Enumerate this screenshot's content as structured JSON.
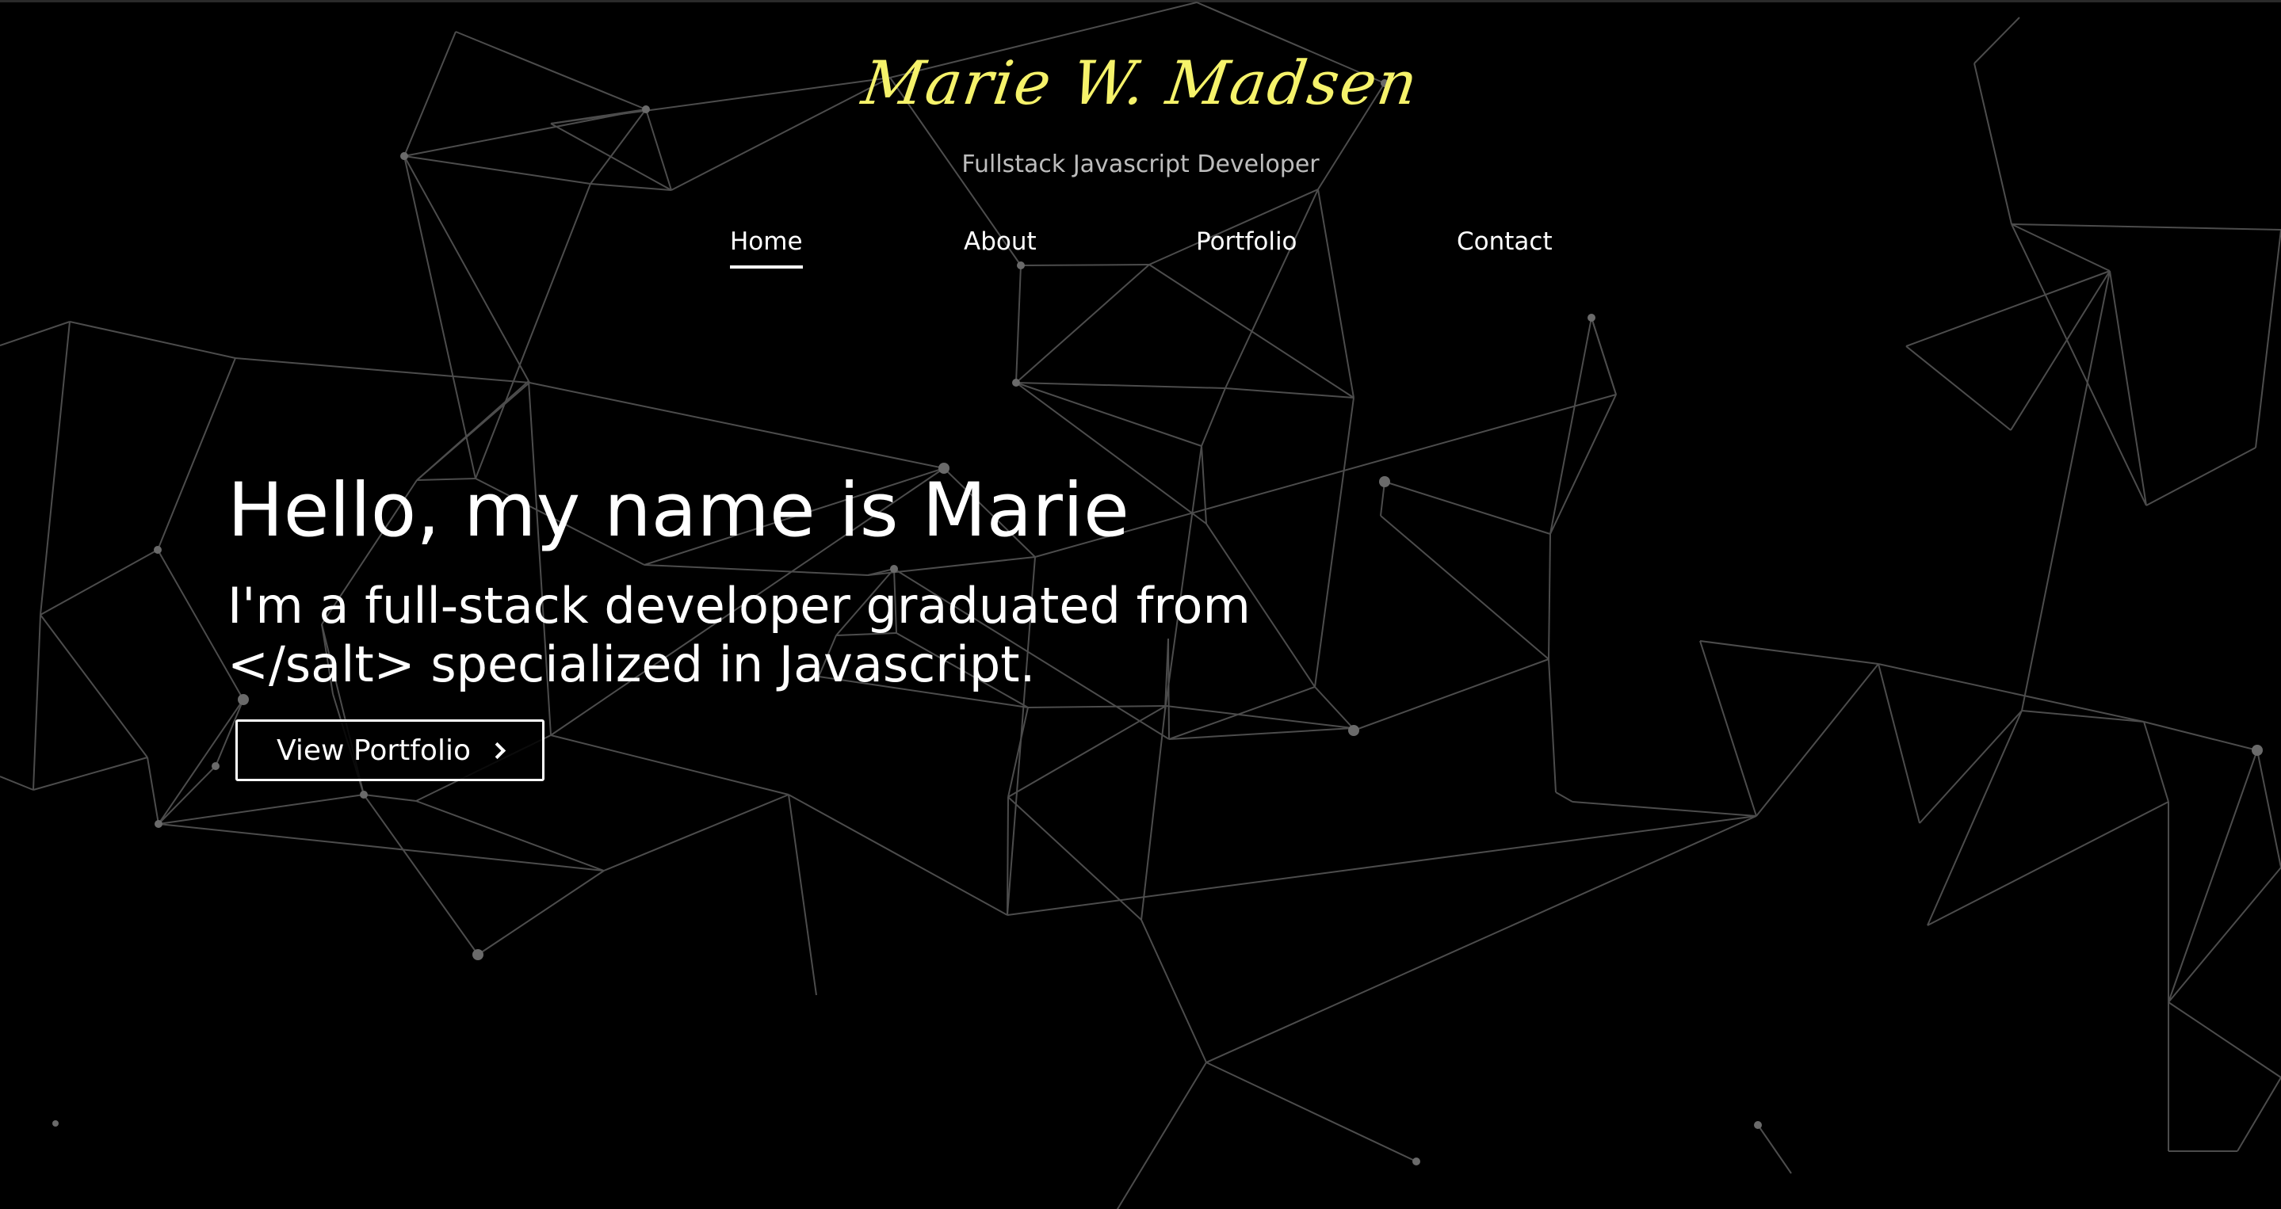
{
  "header": {
    "brand": "Marie W. Madsen",
    "tagline": "Fullstack Javascript Developer"
  },
  "nav": {
    "items": [
      {
        "label": "Home",
        "active": true
      },
      {
        "label": "About",
        "active": false
      },
      {
        "label": "Portfolio",
        "active": false
      },
      {
        "label": "Contact",
        "active": false
      }
    ]
  },
  "hero": {
    "title": "Hello, my name is Marie",
    "subtitle": "I'm a full-stack developer graduated from </salt> specialized in Javascript.",
    "cta_label": "View Portfolio",
    "cta_icon": "chevron-right-icon"
  },
  "colors": {
    "background": "#000000",
    "brand": "#f5f26a",
    "text": "#ffffff",
    "tagline": "#bdbdbd",
    "network_line": "#5a5a5a",
    "network_node": "#6a6a6a"
  }
}
